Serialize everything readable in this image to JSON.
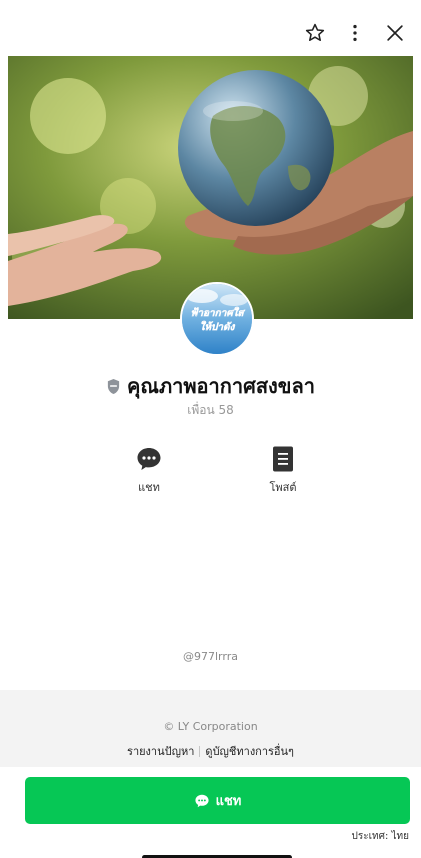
{
  "header": {
    "icons": [
      "star-icon",
      "more-vertical-icon",
      "close-icon"
    ]
  },
  "profile": {
    "avatar_text_line1": "ฟ้าอากาศใส",
    "avatar_text_line2": "ให้ปาดัง",
    "name": "คุณภาพอากาศสงขลา",
    "friends": "เพื่อน 58",
    "badge_icon": "shield-badge-icon"
  },
  "actions": {
    "chat_label": "แชท",
    "post_label": "โพสต์"
  },
  "line_id": "@977lrrra",
  "footer": {
    "copyright": "© LY Corporation",
    "report": "รายงานปัญหา",
    "other_accounts": "ดูบัญชีทางการอื่นๆ"
  },
  "chat_button": {
    "label": "แชท"
  },
  "country": "ประเทศ: ไทย",
  "colors": {
    "line_green": "#06c755",
    "footer_bg": "#f3f3f3"
  }
}
